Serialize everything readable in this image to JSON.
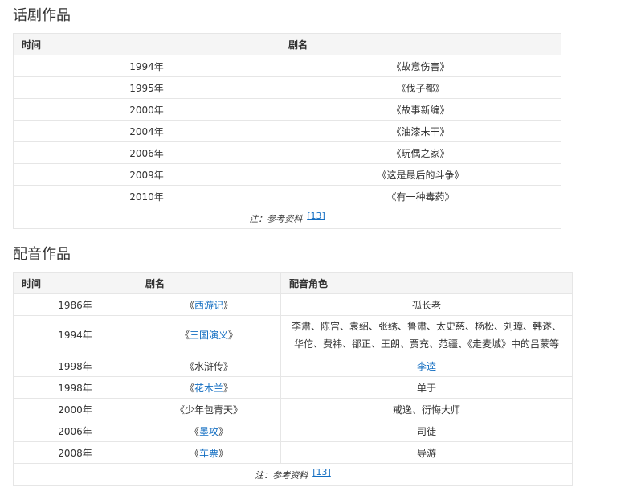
{
  "drama": {
    "title": "话剧作品",
    "headers": [
      "时间",
      "剧名"
    ],
    "rows": [
      {
        "year": "1994年",
        "name": "《故意伤害》"
      },
      {
        "year": "1995年",
        "name": "《伐子都》"
      },
      {
        "year": "2000年",
        "name": "《故事新编》"
      },
      {
        "year": "2004年",
        "name": "《油漆未干》"
      },
      {
        "year": "2006年",
        "name": "《玩偶之家》"
      },
      {
        "year": "2009年",
        "name": "《这是最后的斗争》"
      },
      {
        "year": "2010年",
        "name": "《有一种毒药》"
      }
    ],
    "note": "注：参考资料",
    "note_ref": "[13]"
  },
  "dubbing": {
    "title": "配音作品",
    "headers": [
      "时间",
      "剧名",
      "配音角色"
    ],
    "rows": [
      {
        "year": "1986年",
        "open": "《",
        "name": "西游记",
        "close": "》",
        "name_link": true,
        "role": "孤长老",
        "role_link": false
      },
      {
        "year": "1994年",
        "open": "《",
        "name": "三国演义",
        "close": "》",
        "name_link": true,
        "role_line1": "李肃、陈宫、袁绍、张绣、鲁肃、太史慈、杨松、刘璋、韩遂、",
        "role_line2": "华佗、费祎、郤正、王朗、贾充、范疆、《走麦城》中的吕蒙等",
        "role_link": false
      },
      {
        "year": "1998年",
        "open": "《",
        "name": "水浒传",
        "close": "》",
        "name_link": false,
        "role": "李逵",
        "role_link": true
      },
      {
        "year": "1998年",
        "open": "《",
        "name": "花木兰",
        "close": "》",
        "name_link": true,
        "role": "单于",
        "role_link": false
      },
      {
        "year": "2000年",
        "open": "《",
        "name": "少年包青天",
        "close": "》",
        "name_link": false,
        "role": "戒逸、衍悔大师",
        "role_link": false
      },
      {
        "year": "2006年",
        "open": "《",
        "name": "墨攻",
        "close": "》",
        "name_link": true,
        "role": "司徒",
        "role_link": false
      },
      {
        "year": "2008年",
        "open": "《",
        "name": "车票",
        "close": "》",
        "name_link": true,
        "role": "导游",
        "role_link": false
      }
    ],
    "note": "注：参考资料",
    "note_ref": "[13]"
  },
  "colors": {
    "link": "#136ec2",
    "header_bg": "#f5f5f5",
    "border": "#e6e6e6"
  }
}
